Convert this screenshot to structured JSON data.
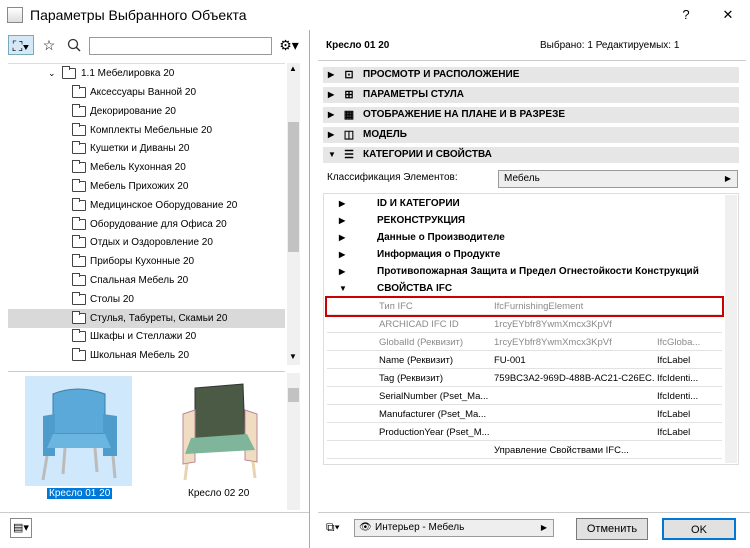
{
  "window": {
    "title": "Параметры Выбранного Объекта",
    "help": "?",
    "close": "✕"
  },
  "left": {
    "search_placeholder": "",
    "tree": {
      "parent": "1.1 Мебелировка 20",
      "items": [
        "Аксессуары Ванной 20",
        "Декорирование 20",
        "Комплекты Мебельные 20",
        "Кушетки и Диваны 20",
        "Мебель Кухонная 20",
        "Мебель Прихожих 20",
        "Медицинское Оборудование 20",
        "Оборудование для Офиса 20",
        "Отдых и Оздоровление 20",
        "Приборы Кухонные 20",
        "Спальная Мебель 20",
        "Столы 20",
        "Стулья, Табуреты, Скамьи 20",
        "Шкафы и Стеллажи 20",
        "Школьная Мебель 20"
      ],
      "selected_index": 12
    },
    "previews": [
      {
        "label": "Кресло 01 20",
        "selected": true
      },
      {
        "label": "Кресло 02 20",
        "selected": false
      }
    ]
  },
  "right": {
    "object_name": "Кресло 01 20",
    "selection_status": "Выбрано: 1 Редактируемых: 1",
    "sections": [
      {
        "label": "ПРОСМОТР И РАСПОЛОЖЕНИЕ",
        "icon": "plan-view-icon",
        "expanded": false
      },
      {
        "label": "ПАРАМЕТРЫ СТУЛА",
        "icon": "grid-params-icon",
        "expanded": false
      },
      {
        "label": "ОТОБРАЖЕНИЕ НА ПЛАНЕ И В РАЗРЕЗЕ",
        "icon": "floorplan-icon",
        "expanded": false
      },
      {
        "label": "МОДЕЛЬ",
        "icon": "cube-icon",
        "expanded": false
      },
      {
        "label": "КАТЕГОРИИ И СВОЙСТВА",
        "icon": "list-icon",
        "expanded": true
      }
    ],
    "classification_label": "Классификация Элементов:",
    "classification_value": "Мебель",
    "categories": [
      "ID И КАТЕГОРИИ",
      "РЕКОНСТРУКЦИЯ",
      "Данные о Производителе",
      "Информация о Продукте",
      "Противопожарная Защита и Предел Огнестойкости Конструкций",
      "СВОЙСТВА IFC"
    ],
    "ifc_rows": [
      {
        "name": "Тип IFC",
        "value": "IfcFurnishingElement",
        "type": "",
        "grey": true,
        "highlight": true
      },
      {
        "name": "ARCHICAD IFC ID",
        "value": "1rcyEYbfr8YwmXmcx3KpVf",
        "type": "",
        "grey": true
      },
      {
        "name": "GlobalId (Реквизит)",
        "value": "1rcyEYbfr8YwmXmcx3KpVf",
        "type": "IfcGloba...",
        "grey": true
      },
      {
        "name": "Name (Реквизит)",
        "value": "FU-001",
        "type": "IfcLabel",
        "grey": false
      },
      {
        "name": "Tag (Реквизит)",
        "value": "759BC3A2-969D-488B-AC21-C26EC...",
        "type": "IfcIdenti...",
        "grey": false
      },
      {
        "name": "SerialNumber (Pset_Ma...",
        "value": "",
        "type": "IfcIdenti...",
        "grey": false
      },
      {
        "name": "Manufacturer (Pset_Ma...",
        "value": "",
        "type": "IfcLabel",
        "grey": false
      },
      {
        "name": "ProductionYear (Pset_M...",
        "value": "",
        "type": "IfcLabel",
        "grey": false
      },
      {
        "name": "",
        "value": "Управление Свойствами IFC...",
        "type": "",
        "grey": false
      }
    ],
    "layer": "Интерьер - Мебель",
    "cancel": "Отменить",
    "ok": "OK"
  },
  "colors": {
    "accent": "#0078d7",
    "highlight": "#cc0000",
    "preview_bg": "#cfe8fb"
  }
}
